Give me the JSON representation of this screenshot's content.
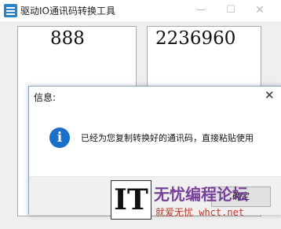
{
  "app": {
    "title": "驱动IO通讯码转换工具"
  },
  "window_controls": {
    "minimize": "—",
    "maximize": "☐",
    "close": "✕"
  },
  "panels": {
    "left_value": "888",
    "right_value": "2236960"
  },
  "dialog": {
    "title": "信息:",
    "message": "已经为您复制转换好的通讯码，直接粘贴使用",
    "ok_label": "确定",
    "close_symbol": "✕",
    "icon_symbol": "i"
  },
  "watermark": {
    "logo_text": "IT",
    "brand": "无忧编程论坛",
    "tagline": "就爱无忧 whct.net"
  }
}
